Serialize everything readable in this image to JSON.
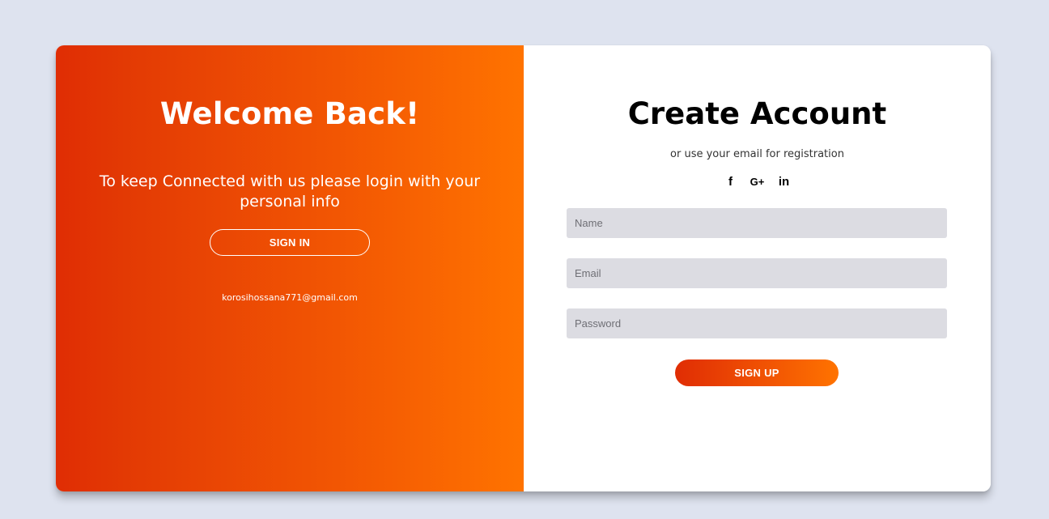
{
  "left_panel": {
    "title": "Welcome Back!",
    "subtitle": "To keep Connected with us please login with your personal info",
    "sign_in_label": "SIGN IN",
    "contact_email": "korosihossana771@gmail.com"
  },
  "right_panel": {
    "title": "Create Account",
    "registration_note": "or use your email for registration",
    "socials": [
      {
        "icon": "facebook-icon",
        "glyph": "f"
      },
      {
        "icon": "google-plus-icon",
        "glyph": "G+"
      },
      {
        "icon": "linkedin-icon",
        "glyph": "in"
      }
    ],
    "fields": {
      "name_placeholder": "Name",
      "email_placeholder": "Email",
      "password_placeholder": "Password"
    },
    "sign_up_label": "SIGN UP"
  },
  "colors": {
    "background": "#dee3ef",
    "gradient_start": "#e02d04",
    "gradient_end": "#ff7300",
    "input_bg": "#dcdce2"
  }
}
